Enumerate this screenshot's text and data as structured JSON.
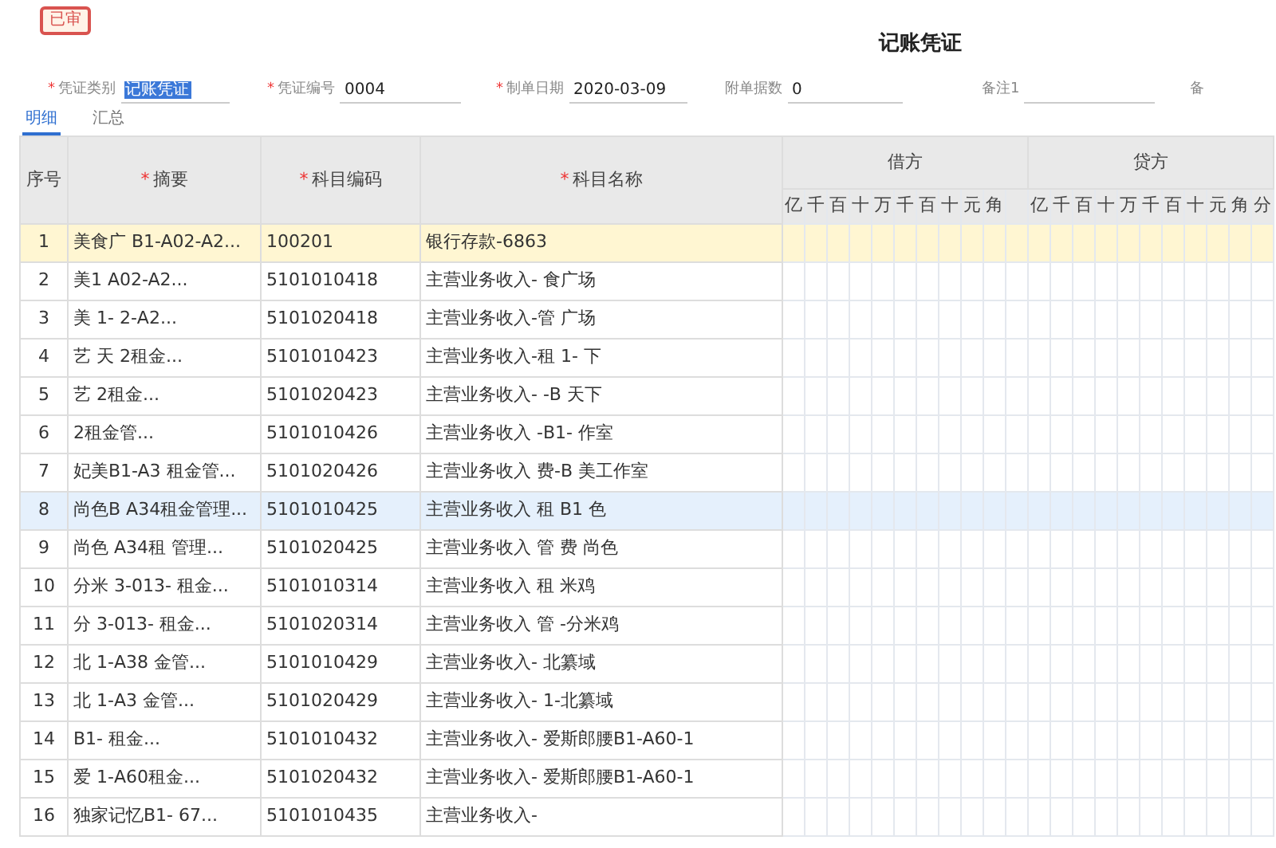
{
  "status_badge": "已审",
  "title": "记账凭证",
  "fields": [
    {
      "required_mark": "*",
      "label": "凭证类别",
      "value": "记账凭证",
      "highlighted": true
    },
    {
      "required_mark": "*",
      "label": "凭证编号",
      "value": "0004",
      "highlighted": false
    },
    {
      "required_mark": "*",
      "label": "制单日期",
      "value": "2020-03-09",
      "highlighted": false
    },
    {
      "label": "附单据数",
      "value": "0",
      "highlighted": false
    },
    {
      "label": "备注1"
    },
    {
      "label": "备"
    }
  ],
  "tabs": [
    {
      "label": "明细",
      "selected": true
    },
    {
      "label": "汇总",
      "selected": false
    }
  ],
  "table": {
    "columns": [
      {
        "label": "序号"
      },
      {
        "required_mark": "*",
        "label": "摘要"
      },
      {
        "required_mark": "*",
        "label": "科目编码"
      },
      {
        "required_mark": "*",
        "label": "科目名称"
      }
    ],
    "amount_groups": [
      {
        "label": "借方",
        "units": [
          "亿",
          "千",
          "百",
          "十",
          "万",
          "千",
          "百",
          "十",
          "元",
          "角"
        ]
      },
      {
        "label": "贷方",
        "units": [
          "亿",
          "千",
          "百",
          "十",
          "万",
          "千",
          "百",
          "十",
          "元",
          "角",
          "分"
        ]
      }
    ],
    "rows": [
      {
        "no": "1",
        "summary": "美食广 B1-A02-A2...",
        "code": "100201",
        "name": "银行存款-6863",
        "current": true,
        "selected": false
      },
      {
        "no": "2",
        "summary": "美1 A02-A2...",
        "code": "5101010418",
        "name": "主营业务收入- 食广场",
        "current": false,
        "selected": false
      },
      {
        "no": "3",
        "summary": "美 1- 2-A2...",
        "code": "5101020418",
        "name": "主营业务收入-管 广场",
        "current": false,
        "selected": false
      },
      {
        "no": "4",
        "summary": "艺 天 2租金...",
        "code": "5101010423",
        "name": "主营业务收入-租 1- 下",
        "current": false,
        "selected": false
      },
      {
        "no": "5",
        "summary": "艺 2租金...",
        "code": "5101020423",
        "name": "主营业务收入- -B 天下",
        "current": false,
        "selected": false
      },
      {
        "no": "6",
        "summary": "2租金管...",
        "code": "5101010426",
        "name": "主营业务收入 -B1- 作室",
        "current": false,
        "selected": false
      },
      {
        "no": "7",
        "summary": "妃美B1-A3 租金管...",
        "code": "5101020426",
        "name": "主营业务收入 费-B 美工作室",
        "current": false,
        "selected": false
      },
      {
        "no": "8",
        "summary": "尚色B A34租金管理...",
        "code": "5101010425",
        "name": "主营业务收入 租 B1 色",
        "current": false,
        "selected": true
      },
      {
        "no": "9",
        "summary": "尚色 A34租 管理...",
        "code": "5101020425",
        "name": "主营业务收入 管 费 尚色",
        "current": false,
        "selected": false
      },
      {
        "no": "10",
        "summary": "分米 3-013- 租金...",
        "code": "5101010314",
        "name": "主营业务收入 租 米鸡",
        "current": false,
        "selected": false
      },
      {
        "no": "11",
        "summary": "分 3-013- 租金...",
        "code": "5101020314",
        "name": "主营业务收入 管 -分米鸡",
        "current": false,
        "selected": false
      },
      {
        "no": "12",
        "summary": "北 1-A38 金管...",
        "code": "5101010429",
        "name": "主营业务收入- 北纂域",
        "current": false,
        "selected": false
      },
      {
        "no": "13",
        "summary": "北 1-A3 金管...",
        "code": "5101020429",
        "name": "主营业务收入- 1-北纂域",
        "current": false,
        "selected": false
      },
      {
        "no": "14",
        "summary": "B1- 租金...",
        "code": "5101010432",
        "name": "主营业务收入- 爱斯郎腰B1-A60-1",
        "current": false,
        "selected": false
      },
      {
        "no": "15",
        "summary": "爱 1-A60租金...",
        "code": "5101020432",
        "name": "主营业务收入- 爱斯郎腰B1-A60-1",
        "current": false,
        "selected": false
      },
      {
        "no": "16",
        "summary": "独家记忆B1- 67...",
        "code": "5101010435",
        "name": "主营业务收入-",
        "current": false,
        "selected": false
      }
    ]
  }
}
